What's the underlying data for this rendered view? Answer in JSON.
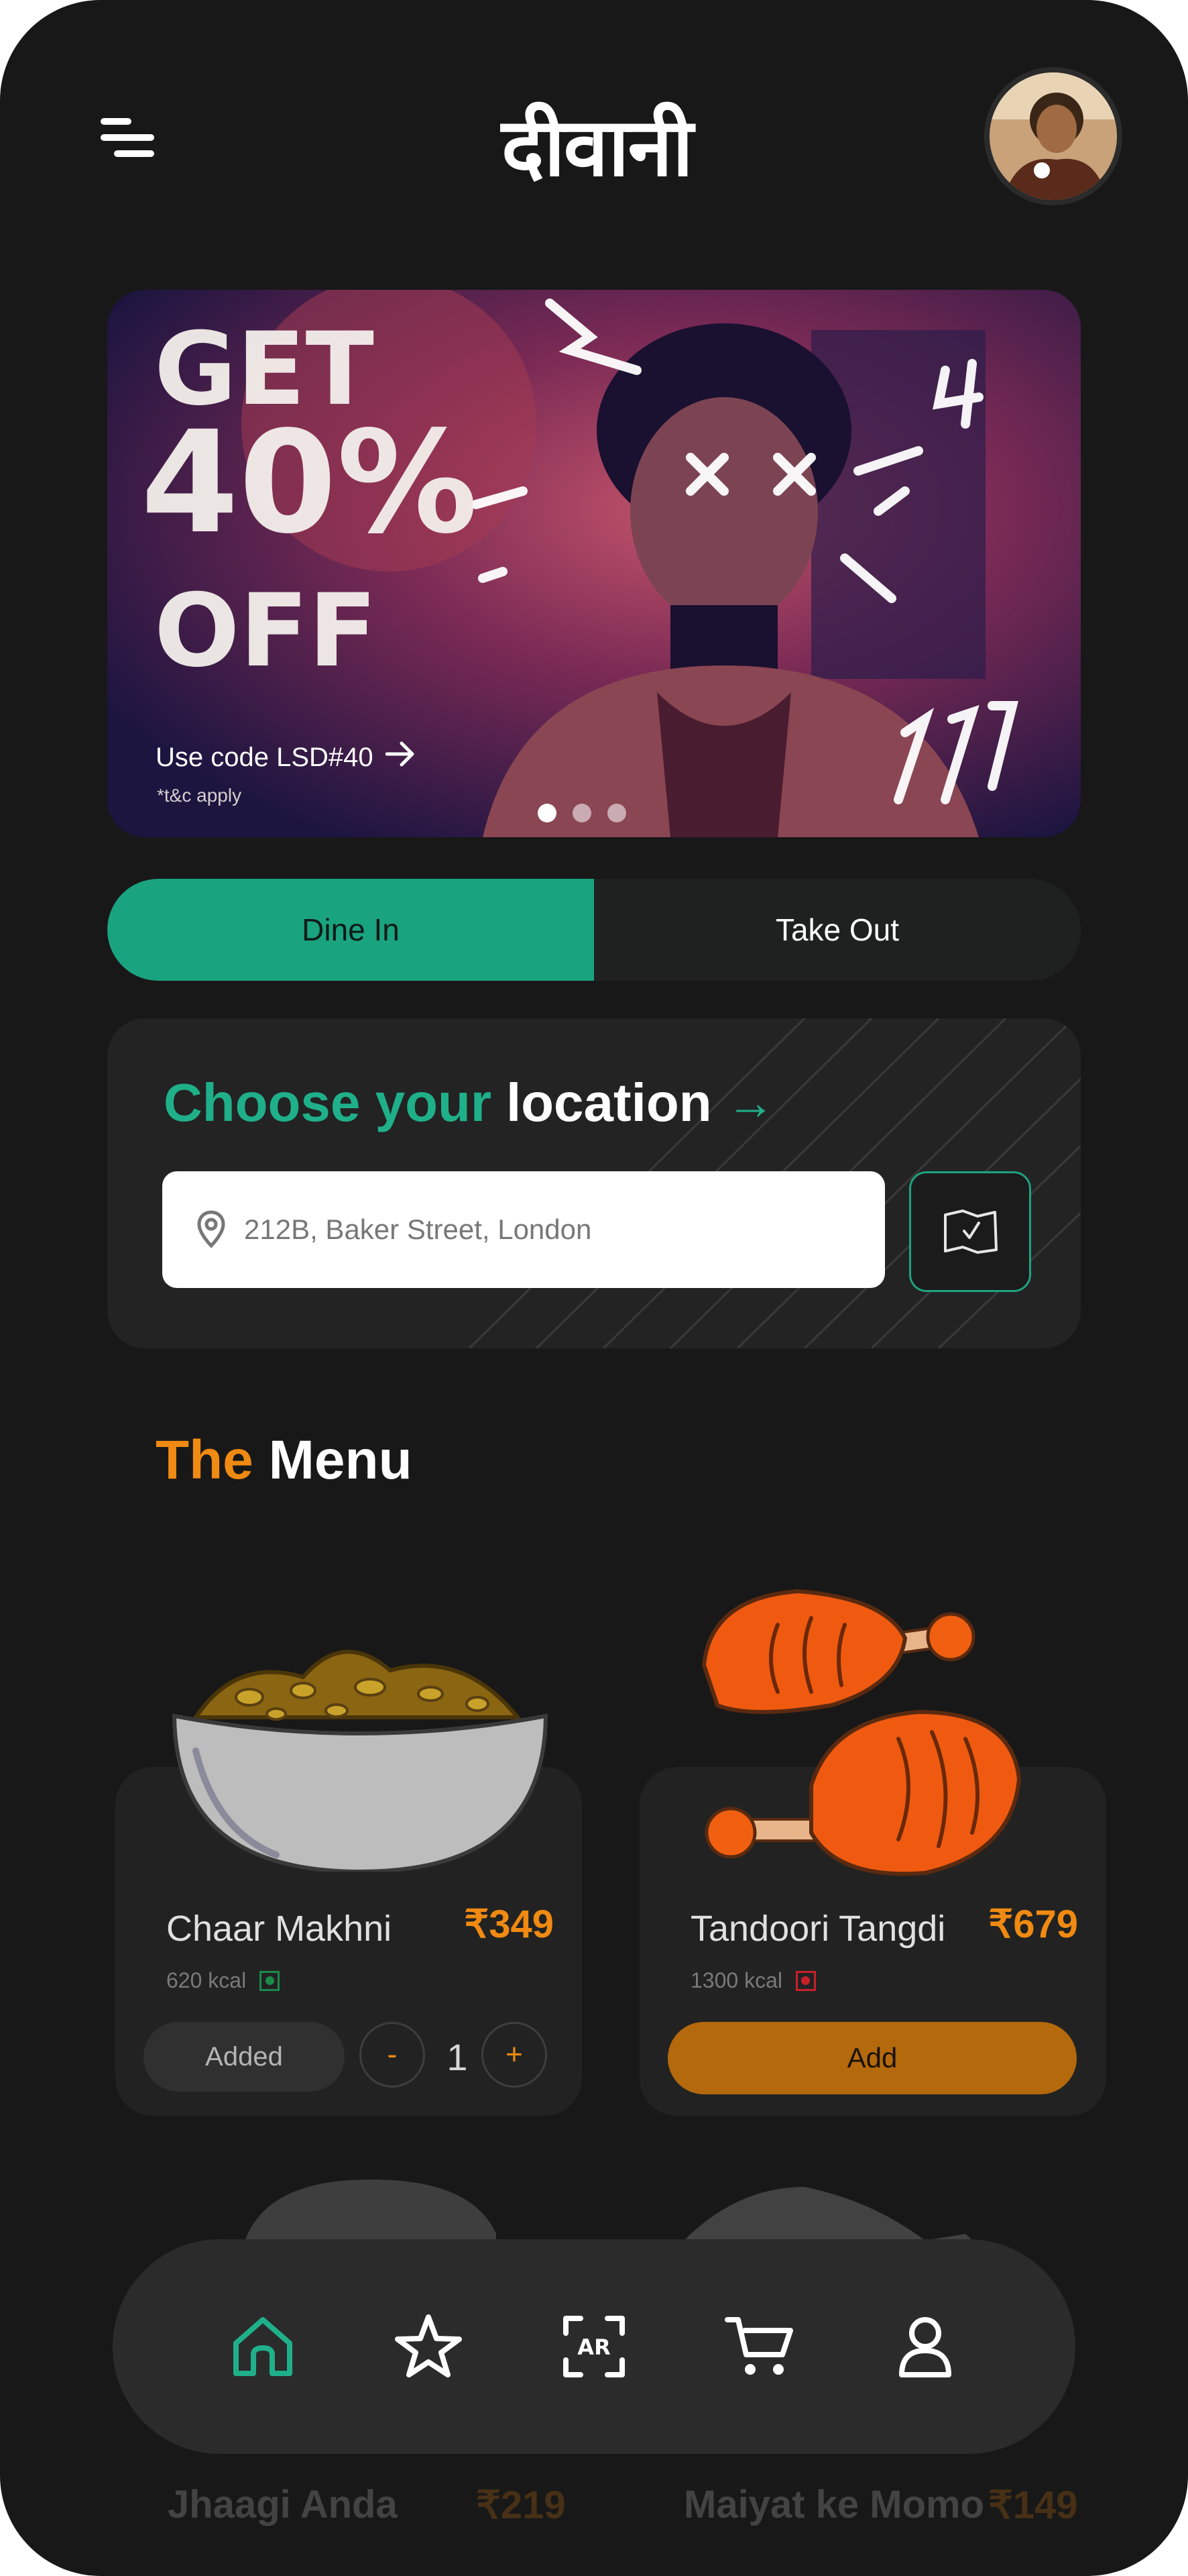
{
  "header": {
    "logo_text": "दीवानी",
    "menu_icon": "hamburger-icon",
    "avatar_icon": "profile-avatar"
  },
  "promo": {
    "line1": "GET",
    "line2": "40%",
    "line3": "OFF",
    "code_text": "Use code LSD#40",
    "terms": "*t&c apply",
    "slides": 3,
    "active_slide": 1
  },
  "order_mode": {
    "options": [
      "Dine In",
      "Take Out"
    ],
    "selected": "Dine In"
  },
  "location": {
    "title_part1": "Choose your",
    "title_part2": "location",
    "arrow": "→",
    "value": "212B, Baker Street, London",
    "map_icon": "map-check-icon"
  },
  "menu": {
    "heading_part1": "The",
    "heading_part2": "Menu",
    "items": [
      {
        "name": "Chaar Makhni",
        "price": "₹349",
        "kcal": "620 kcal",
        "diet": "veg",
        "added_label": "Added",
        "minus": "-",
        "qty": "1",
        "plus": "+"
      },
      {
        "name": "Tandoori Tangdi",
        "price": "₹679",
        "kcal": "1300 kcal",
        "diet": "non-veg",
        "add_label": "Add"
      },
      {
        "name": "Jhaagi Anda",
        "price": "₹219"
      },
      {
        "name": "Maiyat ke Momo",
        "price": "₹149"
      }
    ]
  },
  "bottom_nav": {
    "items": [
      "home-icon",
      "star-icon",
      "ar-icon",
      "cart-icon",
      "profile-icon"
    ],
    "ar_label": "AR",
    "active": "home-icon"
  },
  "colors": {
    "accent_green": "#1aa37f",
    "accent_orange": "#f08a12",
    "background": "#181818"
  }
}
